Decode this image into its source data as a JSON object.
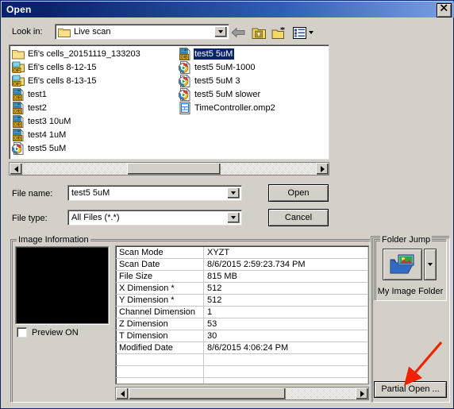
{
  "window": {
    "title": "Open",
    "close_label": "✕"
  },
  "toolbar": {
    "lookin_label": "Look in:",
    "lookin_value": "Live scan",
    "back_icon": "back-arrow-icon",
    "up_icon": "up-one-level-icon",
    "newfolder_icon": "new-folder-icon",
    "views_icon": "views-icon"
  },
  "file_list": {
    "column1": [
      {
        "name": "Efi's cells_20151119_133203",
        "icon": "folder-icon",
        "selected": false
      },
      {
        "name": "Efi's cells 8-12-15",
        "icon": "oif-folder-icon",
        "selected": false
      },
      {
        "name": "Efi's cells 8-13-15",
        "icon": "oif-folder-icon",
        "selected": false
      },
      {
        "name": "test1",
        "icon": "oib-file-icon",
        "selected": false
      },
      {
        "name": "test2",
        "icon": "oib-file-icon",
        "selected": false
      },
      {
        "name": "test3 10uM",
        "icon": "oib-file-icon",
        "selected": false
      },
      {
        "name": "test4 1uM",
        "icon": "oib-file-icon",
        "selected": false
      },
      {
        "name": "test5 5uM",
        "icon": "media-file-icon",
        "selected": false
      }
    ],
    "column2": [
      {
        "name": "test5 5uM",
        "icon": "oib-file-icon",
        "selected": true
      },
      {
        "name": "test5 5uM-1000",
        "icon": "media-file-icon",
        "selected": false
      },
      {
        "name": "test5 5uM 3",
        "icon": "media-file-icon",
        "selected": false
      },
      {
        "name": "test5 5uM slower",
        "icon": "media-file-icon",
        "selected": false
      },
      {
        "name": "TimeController.omp2",
        "icon": "omp2-file-icon",
        "selected": false
      }
    ]
  },
  "form": {
    "filename_label": "File name:",
    "filename_value": "test5 5uM",
    "filetype_label": "File type:",
    "filetype_value": "All Files (*.*)",
    "open_button": "Open",
    "cancel_button": "Cancel"
  },
  "image_information": {
    "group_title": "Image Information",
    "preview_checkbox_label": "Preview ON",
    "preview_checked": false,
    "rows": [
      {
        "key": "Scan Mode",
        "value": "XYZT"
      },
      {
        "key": "Scan Date",
        "value": "8/6/2015 2:59:23.734 PM"
      },
      {
        "key": "File Size",
        "value": "815 MB"
      },
      {
        "key": "X Dimension *",
        "value": "512"
      },
      {
        "key": "Y Dimension *",
        "value": "512"
      },
      {
        "key": "Channel Dimension",
        "value": "1"
      },
      {
        "key": "Z Dimension",
        "value": "53"
      },
      {
        "key": "T Dimension",
        "value": "30"
      },
      {
        "key": "Modified Date",
        "value": "8/6/2015 4:06:24 PM"
      }
    ]
  },
  "folder_jump": {
    "group_title": "Folder Jump",
    "button_label": "My Image Folder",
    "icon": "image-folder-icon",
    "dropdown_icon": "chevron-down-icon"
  },
  "partial_open": {
    "label": "Partial Open ..."
  },
  "annotation": {
    "arrow_color": "#ee2200",
    "points_to": "Partial Open ..."
  },
  "colors": {
    "window_bg": "#d4d0c8",
    "title_start": "#0a246a",
    "title_end": "#7ba0e0",
    "selection": "#0a246a",
    "field_bg": "#ffffff",
    "arrow_red": "#ee2200"
  }
}
